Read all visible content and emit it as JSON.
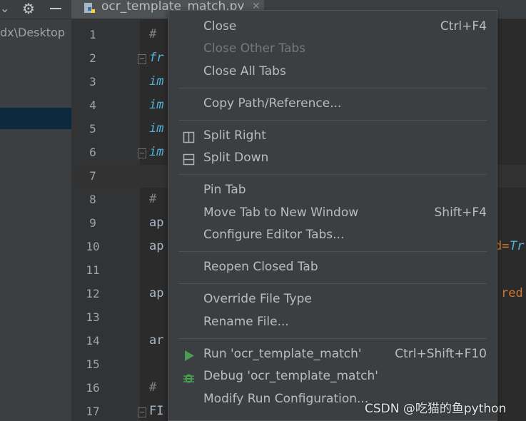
{
  "project_pane": {
    "path_text": "dx\\Desktop"
  },
  "editor_tab": {
    "label": "ocr_template_match.py",
    "close_glyph": "✕"
  },
  "gutter": {
    "line_numbers": [
      "1",
      "2",
      "3",
      "4",
      "5",
      "6",
      "7",
      "8",
      "9",
      "10",
      "11",
      "12",
      "13",
      "14",
      "15",
      "16",
      "17"
    ]
  },
  "code": {
    "lines": {
      "l1": "#",
      "l2": "fr",
      "l3": "im",
      "l4": "im",
      "l5": "im",
      "l6": "im",
      "l8": "#",
      "l9": "ap",
      "l10": "ap",
      "l12": "ap",
      "l14": "ar",
      "l16": "#",
      "l17": "FI"
    },
    "right_fragments": {
      "l10_eq": "d=",
      "l10_val": "Tr",
      "l12": "red"
    }
  },
  "context_menu": {
    "items": [
      {
        "label": "Close",
        "shortcut": "Ctrl+F4",
        "enabled": true
      },
      {
        "label": "Close Other Tabs",
        "shortcut": "",
        "enabled": false
      },
      {
        "label": "Close All Tabs",
        "shortcut": "",
        "enabled": true
      },
      {
        "label": "Copy Path/Reference...",
        "shortcut": "",
        "enabled": true
      },
      {
        "label": "Split Right",
        "shortcut": "",
        "enabled": true,
        "icon": "split-right-icon"
      },
      {
        "label": "Split Down",
        "shortcut": "",
        "enabled": true,
        "icon": "split-down-icon"
      },
      {
        "label": "Pin Tab",
        "shortcut": "",
        "enabled": true
      },
      {
        "label": "Move Tab to New Window",
        "shortcut": "Shift+F4",
        "enabled": true
      },
      {
        "label": "Configure Editor Tabs...",
        "shortcut": "",
        "enabled": true
      },
      {
        "label": "Reopen Closed Tab",
        "shortcut": "",
        "enabled": true
      },
      {
        "label": "Override File Type",
        "shortcut": "",
        "enabled": true
      },
      {
        "label": "Rename File...",
        "shortcut": "",
        "enabled": true
      },
      {
        "label": "Run 'ocr_template_match'",
        "shortcut": "Ctrl+Shift+F10",
        "enabled": true,
        "icon": "run-icon"
      },
      {
        "label": "Debug 'ocr_template_match'",
        "shortcut": "",
        "enabled": true,
        "icon": "debug-icon"
      },
      {
        "label": "Modify Run Configuration...",
        "shortcut": "",
        "enabled": true
      }
    ]
  },
  "colors": {
    "run_green": "#499c54",
    "debug_green": "#499c54",
    "keyword_cyan": "#4fb4d8",
    "string_red": "#cc7832"
  },
  "watermark": {
    "text": "CSDN @吃猫的鱼python"
  }
}
